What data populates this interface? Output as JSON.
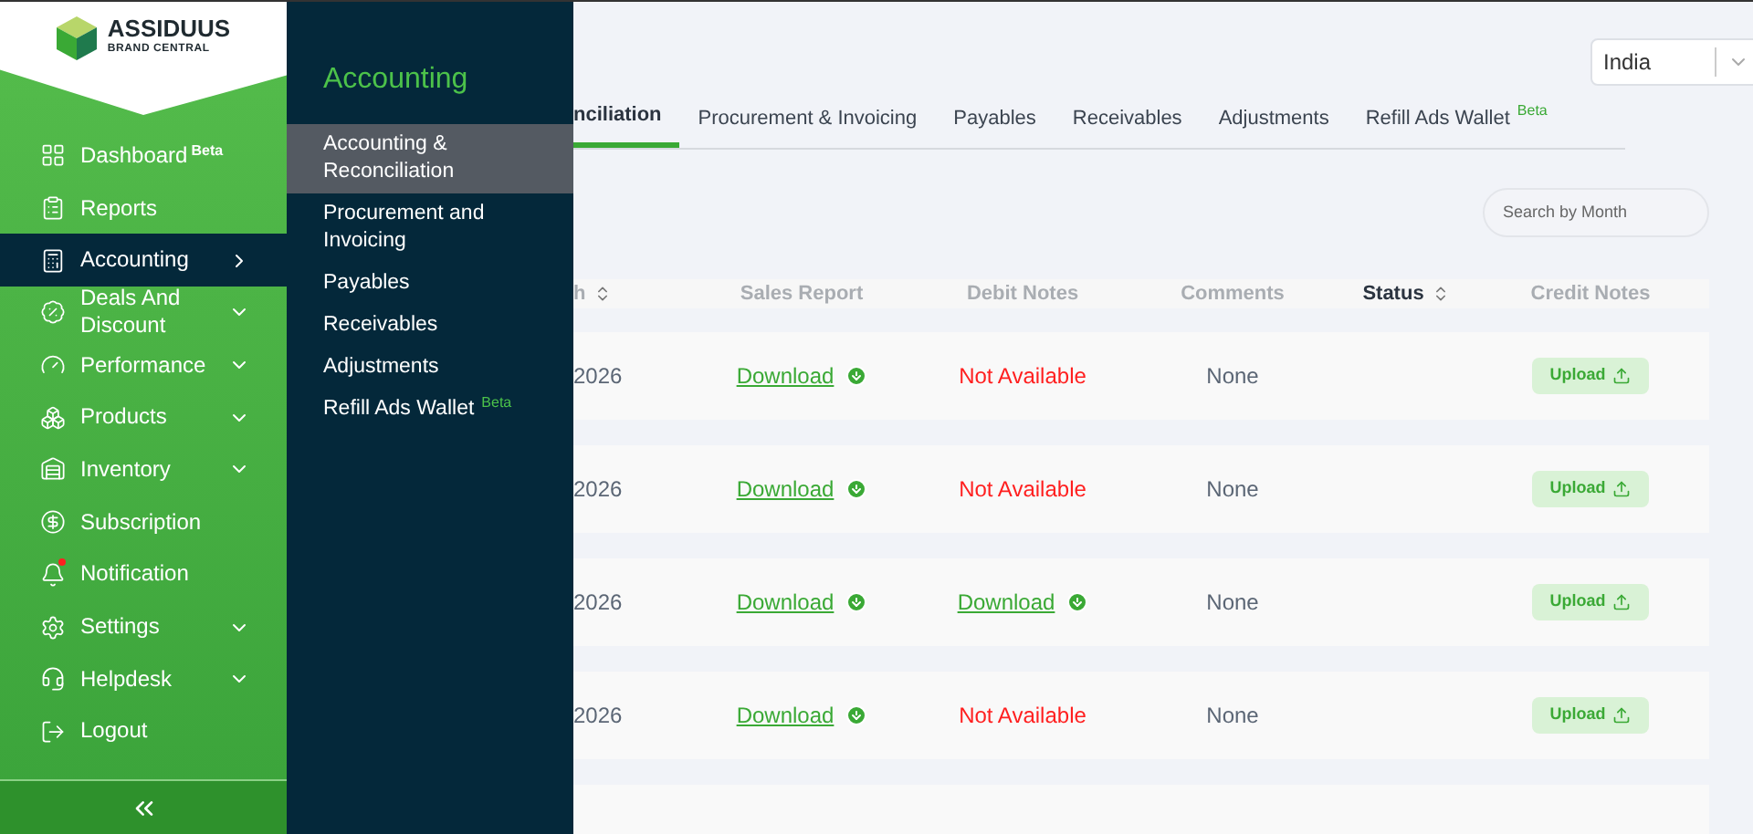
{
  "logo": {
    "name": "ASSIDUUS",
    "tagline": "BRAND CENTRAL"
  },
  "sidebar": {
    "items": [
      {
        "kind": "dashboard",
        "label": "Dashboard",
        "badge": "Beta",
        "selected": false
      },
      {
        "kind": "reports",
        "label": "Reports",
        "selected": false
      },
      {
        "kind": "accounting",
        "label": "Accounting",
        "has_submenu": true,
        "selected": true
      },
      {
        "kind": "deals",
        "label": "Deals And Discount",
        "has_submenu": true,
        "selected": false
      },
      {
        "kind": "performance",
        "label": "Performance",
        "has_submenu": true,
        "selected": false
      },
      {
        "kind": "products",
        "label": "Products",
        "has_submenu": true,
        "selected": false
      },
      {
        "kind": "inventory",
        "label": "Inventory",
        "has_submenu": true,
        "selected": false
      },
      {
        "kind": "subscription",
        "label": "Subscription",
        "selected": false
      },
      {
        "kind": "notification",
        "label": "Notification",
        "unread": true,
        "selected": false
      },
      {
        "kind": "settings",
        "label": "Settings",
        "has_submenu": true,
        "selected": false
      },
      {
        "kind": "helpdesk",
        "label": "Helpdesk",
        "has_submenu": true,
        "selected": false
      },
      {
        "kind": "logout",
        "label": "Logout",
        "selected": false
      }
    ]
  },
  "flyout": {
    "title": "Accounting",
    "items": [
      {
        "label": "Accounting & Reconciliation",
        "selected": true
      },
      {
        "label": "Procurement and Invoicing",
        "selected": false
      },
      {
        "label": "Payables",
        "selected": false
      },
      {
        "label": "Receivables",
        "selected": false
      },
      {
        "label": "Adjustments",
        "selected": false
      },
      {
        "label": "Refill Ads Wallet",
        "badge": "Beta",
        "selected": false
      }
    ]
  },
  "country_select": {
    "value": "India"
  },
  "tabs": [
    {
      "label": "nciliation",
      "selected": true
    },
    {
      "label": "Procurement & Invoicing",
      "selected": false
    },
    {
      "label": "Payables",
      "selected": false
    },
    {
      "label": "Receivables",
      "selected": false
    },
    {
      "label": "Adjustments",
      "selected": false
    },
    {
      "label": "Refill Ads Wallet",
      "badge": "Beta",
      "selected": false
    }
  ],
  "search": {
    "placeholder": "Search by Month"
  },
  "table": {
    "columns": [
      {
        "label": "h",
        "sortable": true,
        "bold": false
      },
      {
        "label": "Sales Report",
        "sortable": false,
        "bold": false
      },
      {
        "label": "Debit Notes",
        "sortable": false,
        "bold": false
      },
      {
        "label": "Comments",
        "sortable": false,
        "bold": false
      },
      {
        "label": "Status",
        "sortable": true,
        "bold": true
      },
      {
        "label": "Credit Notes",
        "sortable": false,
        "bold": false
      }
    ],
    "rows": [
      {
        "month": "2026",
        "sales_report": {
          "kind": "link",
          "text": "Download"
        },
        "debit_notes": {
          "kind": "unavailable",
          "text": "Not Available"
        },
        "comments": "None",
        "credit_notes": "Upload"
      },
      {
        "month": "2026",
        "sales_report": {
          "kind": "link",
          "text": "Download"
        },
        "debit_notes": {
          "kind": "unavailable",
          "text": "Not Available"
        },
        "comments": "None",
        "credit_notes": "Upload"
      },
      {
        "month": "2026",
        "sales_report": {
          "kind": "link",
          "text": "Download"
        },
        "debit_notes": {
          "kind": "link",
          "text": "Download"
        },
        "comments": "None",
        "credit_notes": "Upload"
      },
      {
        "month": "2026",
        "sales_report": {
          "kind": "link",
          "text": "Download"
        },
        "debit_notes": {
          "kind": "unavailable",
          "text": "Not Available"
        },
        "comments": "None",
        "credit_notes": "Upload"
      }
    ]
  }
}
